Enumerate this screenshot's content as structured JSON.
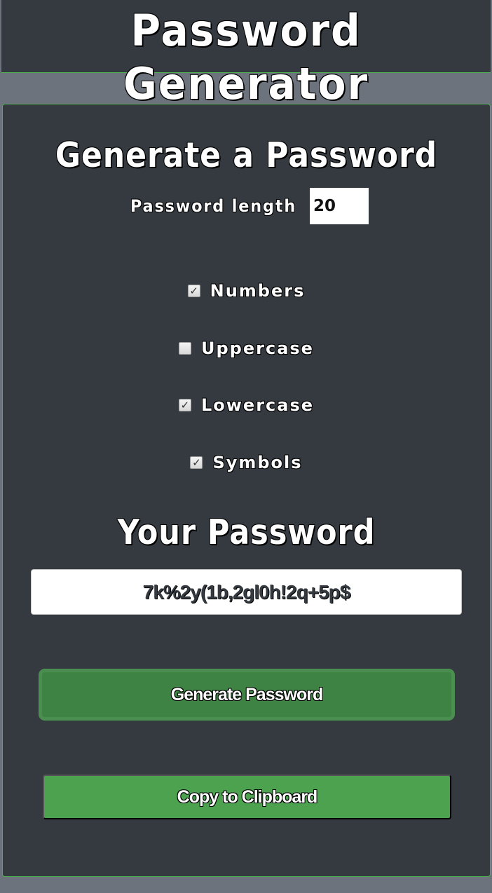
{
  "header": {
    "title": "Password Generator"
  },
  "form": {
    "heading": "Generate a Password",
    "length_label": "Password length",
    "length_value": "20",
    "options": [
      {
        "label": "Numbers",
        "checked": true
      },
      {
        "label": "Uppercase",
        "checked": false
      },
      {
        "label": "Lowercase",
        "checked": true
      },
      {
        "label": "Symbols",
        "checked": true
      }
    ],
    "result_heading": "Your Password",
    "password": "7k%2y(1b,2gl0h!2q+5p$",
    "generate_label": "Generate Password",
    "copy_label": "Copy to Clipboard"
  },
  "colors": {
    "page_bg": "#6c737c",
    "panel_bg": "#343a40",
    "accent": "#4caf50",
    "generate_button": "#3e8244",
    "copy_button": "#4ca24f",
    "text": "#ffffff"
  },
  "icons": {
    "checked": "check-icon"
  }
}
